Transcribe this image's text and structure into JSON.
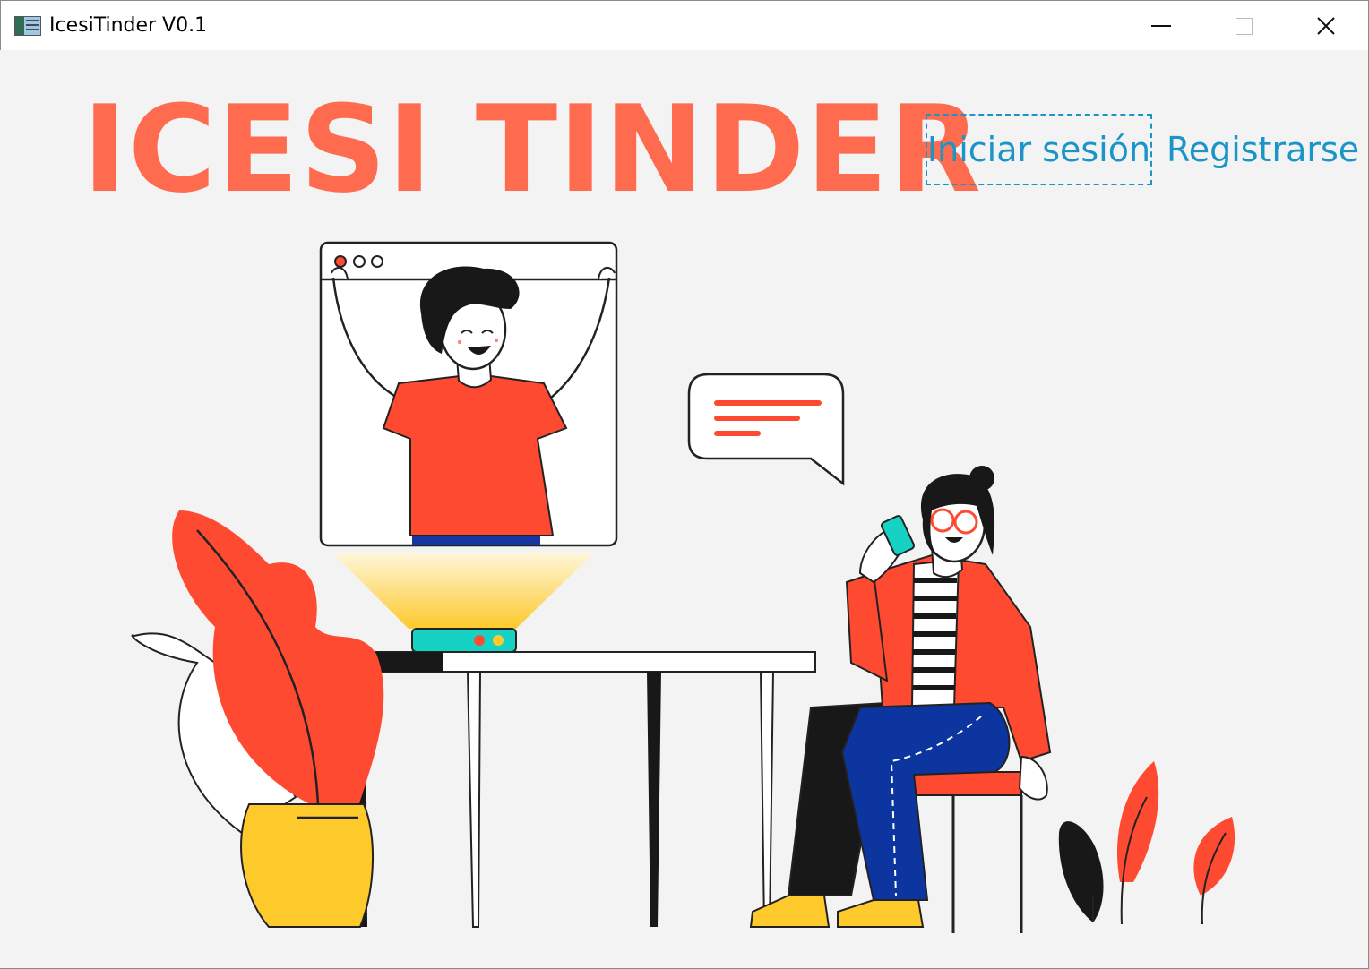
{
  "window": {
    "title": "IcesiTinder V0.1"
  },
  "header": {
    "brand": "ICESI TINDER",
    "login_label": "Iniciar sesión",
    "register_label": "Registrarse"
  },
  "colors": {
    "brand": "#fe6b4f",
    "link": "#1b95c8",
    "background": "#f3f3f3"
  },
  "icons": [
    "app-icon",
    "minimize-icon",
    "maximize-icon",
    "close-icon"
  ]
}
